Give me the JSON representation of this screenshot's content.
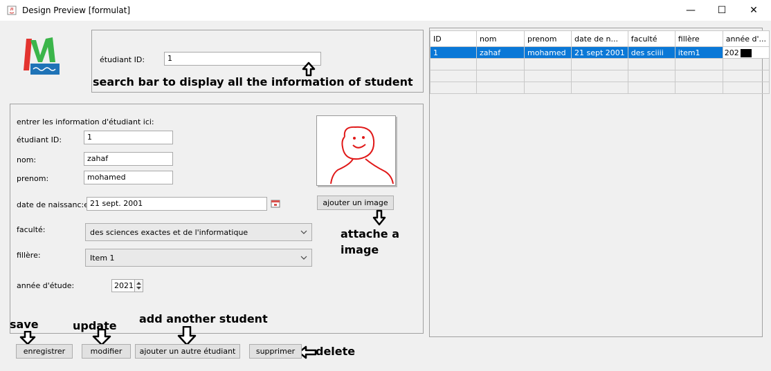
{
  "window": {
    "title": "Design Preview [formulat]",
    "controls": {
      "minimize": "—",
      "maximize": "☐",
      "close": "✕"
    }
  },
  "search": {
    "label": "étudiant ID:",
    "value": "1",
    "annotation": "search bar to display all the information of student"
  },
  "form": {
    "heading": "entrer les information d'étudiant ici:",
    "student_id": {
      "label": "étudiant ID:",
      "value": "1"
    },
    "nom": {
      "label": "nom:",
      "value": "zahaf"
    },
    "prenom": {
      "label": "prenom:",
      "value": "mohamed"
    },
    "date": {
      "label": "date de naissanc:e",
      "value": "21 sept. 2001"
    },
    "faculte": {
      "label": "faculté:",
      "value": "des sciences exactes et de l'informatique"
    },
    "filiere": {
      "label": "fillère:",
      "value": "Item 1"
    },
    "annee": {
      "label": "année d'étude:",
      "value": "2021"
    }
  },
  "image": {
    "button_label": "ajouter un image",
    "annotation_line1": "attache a",
    "annotation_line2": "image"
  },
  "buttons": {
    "save": "enregistrer",
    "update": "modifier",
    "add_student": "ajouter un autre étudiant",
    "delete": "supprimer"
  },
  "annotations": {
    "save": "save",
    "update": "update",
    "add_student": "add another student",
    "delete": "delete"
  },
  "table": {
    "columns": [
      "ID",
      "nom",
      "prenom",
      "date de n...",
      "faculté",
      "fillère",
      "année d'..."
    ],
    "rows": [
      [
        "1",
        "zahaf",
        "mohamed",
        "21 sept 2001",
        "des sciiii",
        "item1",
        "202"
      ],
      [
        "",
        "",
        "",
        "",
        "",
        "",
        ""
      ],
      [
        "",
        "",
        "",
        "",
        "",
        "",
        ""
      ],
      [
        "",
        "",
        "",
        "",
        "",
        "",
        ""
      ]
    ]
  },
  "colors": {
    "selection": "#0a78d7",
    "logo_red": "#e3342f",
    "logo_green": "#3bb54a",
    "logo_blue": "#1f73b7"
  }
}
